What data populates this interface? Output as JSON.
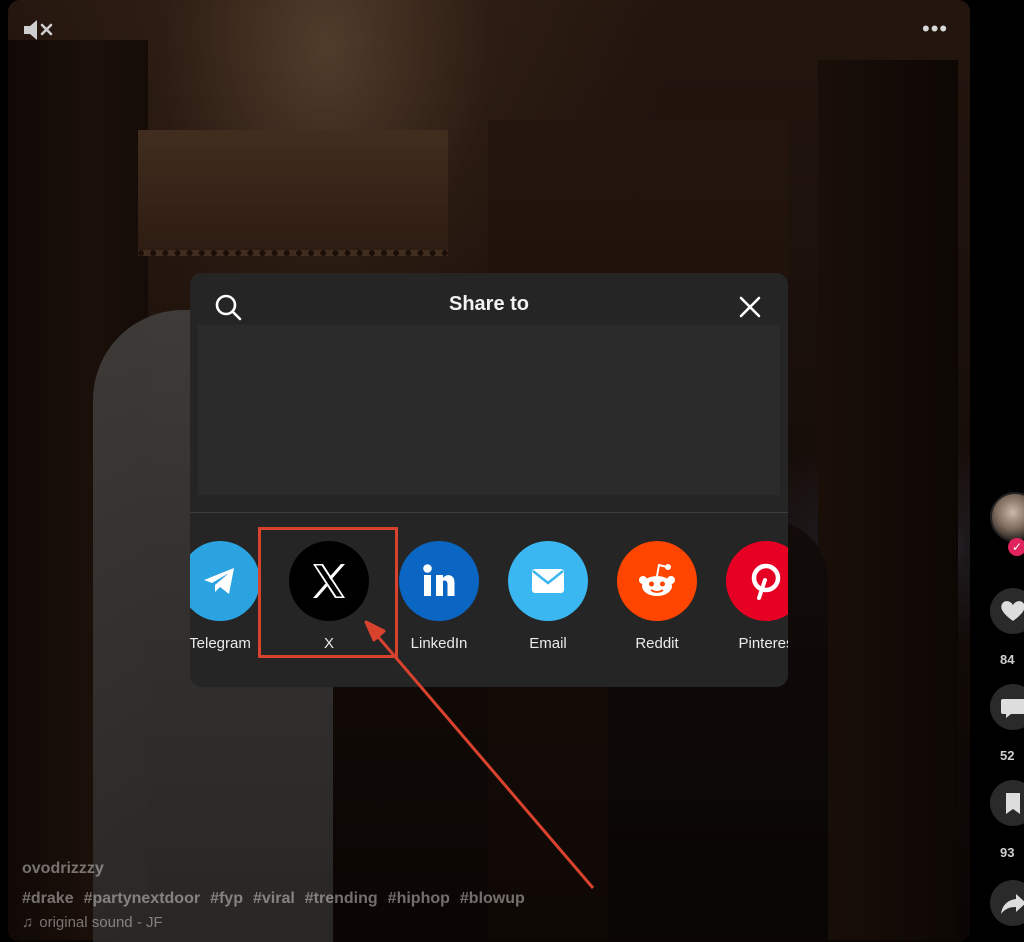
{
  "video": {
    "username": "ovodrizzzy",
    "hashtags": [
      "#drake",
      "#partynextdoor",
      "#fyp",
      "#viral",
      "#trending",
      "#hiphop",
      "#blowup"
    ],
    "sound": "original sound - JF",
    "more_label": "•••"
  },
  "rail": {
    "follow_mark": "✓",
    "like_count": "84",
    "comment_count": "52",
    "save_count": "93"
  },
  "share_modal": {
    "title": "Share to",
    "apps": [
      {
        "label": "Telegram",
        "icon": "telegram-icon",
        "color": "#2aa3e0"
      },
      {
        "label": "X",
        "icon": "x-logo-icon",
        "color": "#000000"
      },
      {
        "label": "LinkedIn",
        "icon": "linkedin-icon",
        "color": "#0a66c2"
      },
      {
        "label": "Email",
        "icon": "email-icon",
        "color": "#3ab7f0"
      },
      {
        "label": "Reddit",
        "icon": "reddit-icon",
        "color": "#ff4500"
      },
      {
        "label": "Pinteres",
        "icon": "pinterest-icon",
        "color": "#e60023"
      }
    ]
  },
  "annotation": {
    "color": "#d9432e"
  }
}
